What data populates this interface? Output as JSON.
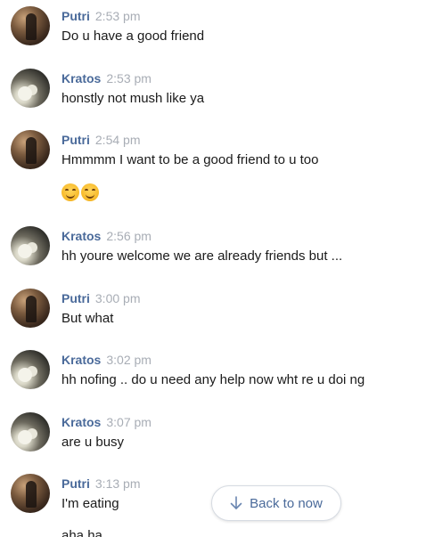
{
  "messages": [
    {
      "author": "Putri",
      "time": "2:53 pm",
      "text": "Do u have a good friend"
    },
    {
      "author": "Kratos",
      "time": "2:53 pm",
      "text": "honstly not mush like ya"
    },
    {
      "author": "Putri",
      "time": "2:54 pm",
      "text": "Hmmmm I want to be a good friend to u too"
    },
    {
      "author": "Kratos",
      "time": "2:56 pm",
      "text": "hh youre welcome we are already friends but ..."
    },
    {
      "author": "Putri",
      "time": "3:00 pm",
      "text": "But what"
    },
    {
      "author": "Kratos",
      "time": "3:02 pm",
      "text": "hh nofing .. do u need any help now wht re u doi ng"
    },
    {
      "author": "Kratos",
      "time": "3:07 pm",
      "text": "are u busy"
    },
    {
      "author": "Putri",
      "time": "3:13 pm",
      "text": "I'm eating"
    }
  ],
  "emoji": [
    "smiling-face-icon",
    "smiling-face-icon"
  ],
  "back_button": {
    "label": "Back to now",
    "icon": "arrow-down-icon"
  },
  "partial_next_line": "aha ha",
  "colors": {
    "name": "#4a6a9a",
    "time": "#a8adb5",
    "text": "#1a1a1a",
    "emoji": "#f7b928"
  }
}
